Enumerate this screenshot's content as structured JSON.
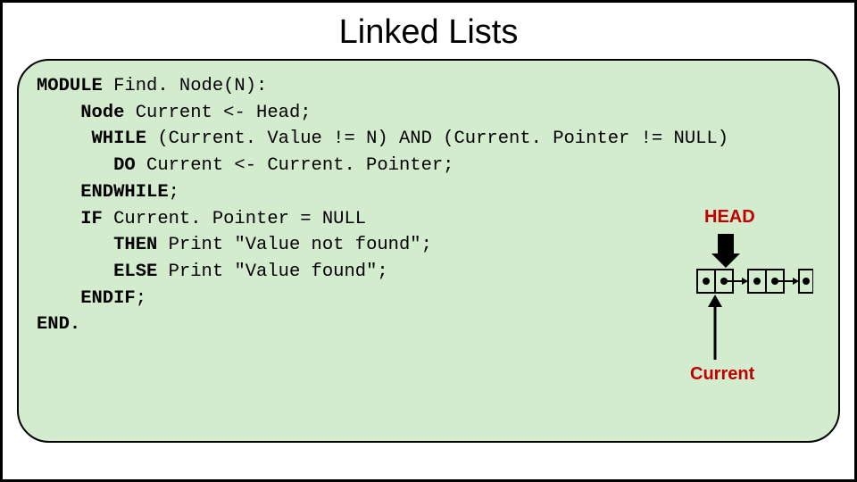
{
  "title": "Linked Lists",
  "code": {
    "l1a": "MODULE",
    "l1b": " Find. Node(N):",
    "l2a": "    Node",
    "l2b": " Current <- Head;",
    "l3a": "     WHILE",
    "l3b": " (Current. Value != N) AND (Current. Pointer != NULL)",
    "l4a": "       DO",
    "l4b": " Current <- Current. Pointer;",
    "l5a": "    ENDWHILE",
    "l5b": ";",
    "l6a": "    IF",
    "l6b": " Current. Pointer = NULL",
    "l7a": "       THEN",
    "l7b": " Print \"Value not found\";",
    "l8a": "       ELSE",
    "l8b": " Print \"Value found\";",
    "l9a": "    ENDIF",
    "l9b": ";",
    "l10a": "END.",
    "l10b": ""
  },
  "diagram": {
    "head": "HEAD",
    "current": "Current"
  }
}
